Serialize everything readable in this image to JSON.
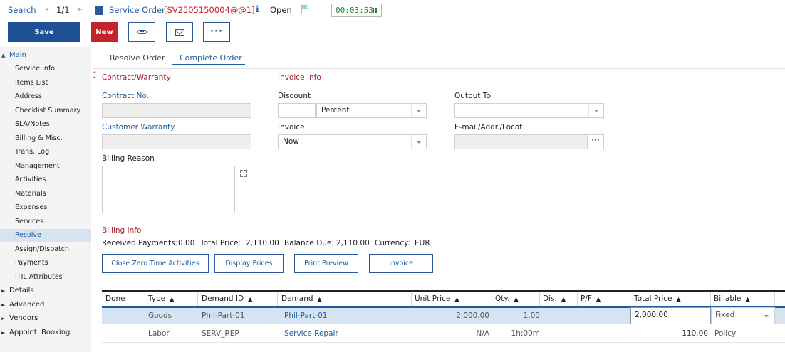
{
  "topbar": {
    "search_label": "Search",
    "prev_arrow": "◄",
    "record_counter": "1/1",
    "next_arrow": "►",
    "title": "Service Order",
    "order_id": "[SV2505150004@@1]",
    "info_glyph": "i",
    "status": "Open",
    "timer": "00:03:53"
  },
  "actions": {
    "save": "Save",
    "new": "New",
    "more_glyph": "···"
  },
  "sidebar": {
    "main_group": "Main",
    "items": [
      "Service Info.",
      "Items List",
      "Address",
      "Checklist Summary",
      "SLA/Notes",
      "Billing & Misc.",
      "Trans. Log",
      "Management",
      "Activities",
      "Materials",
      "Expenses",
      "Services",
      "Resolve",
      "Assign/Dispatch",
      "Payments",
      "ITIL Attributes"
    ],
    "active_item": "Resolve",
    "groups": [
      "Details",
      "Advanced",
      "Vendors",
      "Appoint. Booking"
    ]
  },
  "tabs": [
    "Resolve Order",
    "Complete Order"
  ],
  "active_tab": "Complete Order",
  "contract": {
    "section_title": "Contract/Warranty",
    "contract_no_label": "Contract No.",
    "contract_no_value": "",
    "customer_warranty_label": "Customer Warranty",
    "customer_warranty_value": "",
    "billing_reason_label": "Billing Reason",
    "billing_reason_value": ""
  },
  "invoice": {
    "section_title": "Invoice Info",
    "discount_label": "Discount",
    "discount_value": "",
    "discount_type": "Percent",
    "invoice_label": "Invoice",
    "invoice_value": "Now",
    "output_label": "Output To",
    "output_value": "",
    "email_label": "E-mail/Addr./Locat.",
    "email_value": "",
    "email_button": "···"
  },
  "billing": {
    "section_title": "Billing Info",
    "received_label": "Received Payments:",
    "received_value": "0.00",
    "total_label": "Total Price:",
    "total_value": "2,110.00",
    "balance_label": "Balance Due:",
    "balance_value": "2,110.00",
    "currency_label": "Currency:",
    "currency_value": "EUR",
    "buttons": [
      "Close Zero Time Activities",
      "Display Prices",
      "Print Preview",
      "Invoice"
    ]
  },
  "table": {
    "sort_glyph": "▲",
    "columns": [
      "Done",
      "Type",
      "Demand ID",
      "Demand",
      "Unit Price",
      "Qty.",
      "Dis.",
      "P/F",
      "Total Price",
      "Billable"
    ],
    "rows": [
      {
        "done": "",
        "type": "Goods",
        "demand_id": "Phil-Part-01",
        "demand": "Phil-Part-01",
        "unit_price": "2,000.00",
        "qty": "1.00",
        "dis": "",
        "pf": "",
        "total_price": "2,000.00",
        "billable": "Fixed"
      },
      {
        "done": "",
        "type": "Labor",
        "demand_id": "SERV_REP",
        "demand": "Service Repair",
        "unit_price": "N/A",
        "qty": "1h:00m",
        "dis": "",
        "pf": "",
        "total_price": "110.00",
        "billable": "Policy"
      }
    ]
  },
  "colors": {
    "primary": "#1e5096",
    "danger": "#c1242d",
    "section": "#a2222d",
    "selected_row": "#d6e3f1",
    "timer": "#2e7d32"
  }
}
